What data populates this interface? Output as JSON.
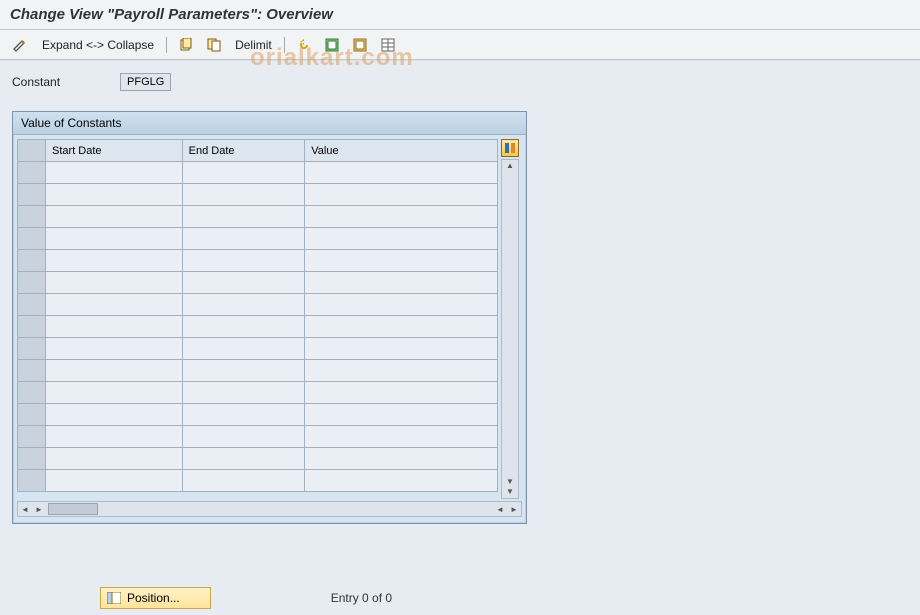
{
  "title": "Change View \"Payroll Parameters\": Overview",
  "watermark": "orialkart.com",
  "toolbar": {
    "expand_collapse": "Expand <-> Collapse",
    "delimit": "Delimit"
  },
  "fields": {
    "constant_label": "Constant",
    "constant_value": "PFGLG"
  },
  "panel": {
    "title": "Value of Constants",
    "columns": {
      "start_date": "Start Date",
      "end_date": "End Date",
      "value": "Value"
    },
    "rows": [
      {
        "start": "",
        "end": "",
        "value": ""
      },
      {
        "start": "",
        "end": "",
        "value": ""
      },
      {
        "start": "",
        "end": "",
        "value": ""
      },
      {
        "start": "",
        "end": "",
        "value": ""
      },
      {
        "start": "",
        "end": "",
        "value": ""
      },
      {
        "start": "",
        "end": "",
        "value": ""
      },
      {
        "start": "",
        "end": "",
        "value": ""
      },
      {
        "start": "",
        "end": "",
        "value": ""
      },
      {
        "start": "",
        "end": "",
        "value": ""
      },
      {
        "start": "",
        "end": "",
        "value": ""
      },
      {
        "start": "",
        "end": "",
        "value": ""
      },
      {
        "start": "",
        "end": "",
        "value": ""
      },
      {
        "start": "",
        "end": "",
        "value": ""
      },
      {
        "start": "",
        "end": "",
        "value": ""
      },
      {
        "start": "",
        "end": "",
        "value": ""
      }
    ]
  },
  "footer": {
    "position_label": "Position...",
    "entry_status": "Entry 0 of 0"
  }
}
